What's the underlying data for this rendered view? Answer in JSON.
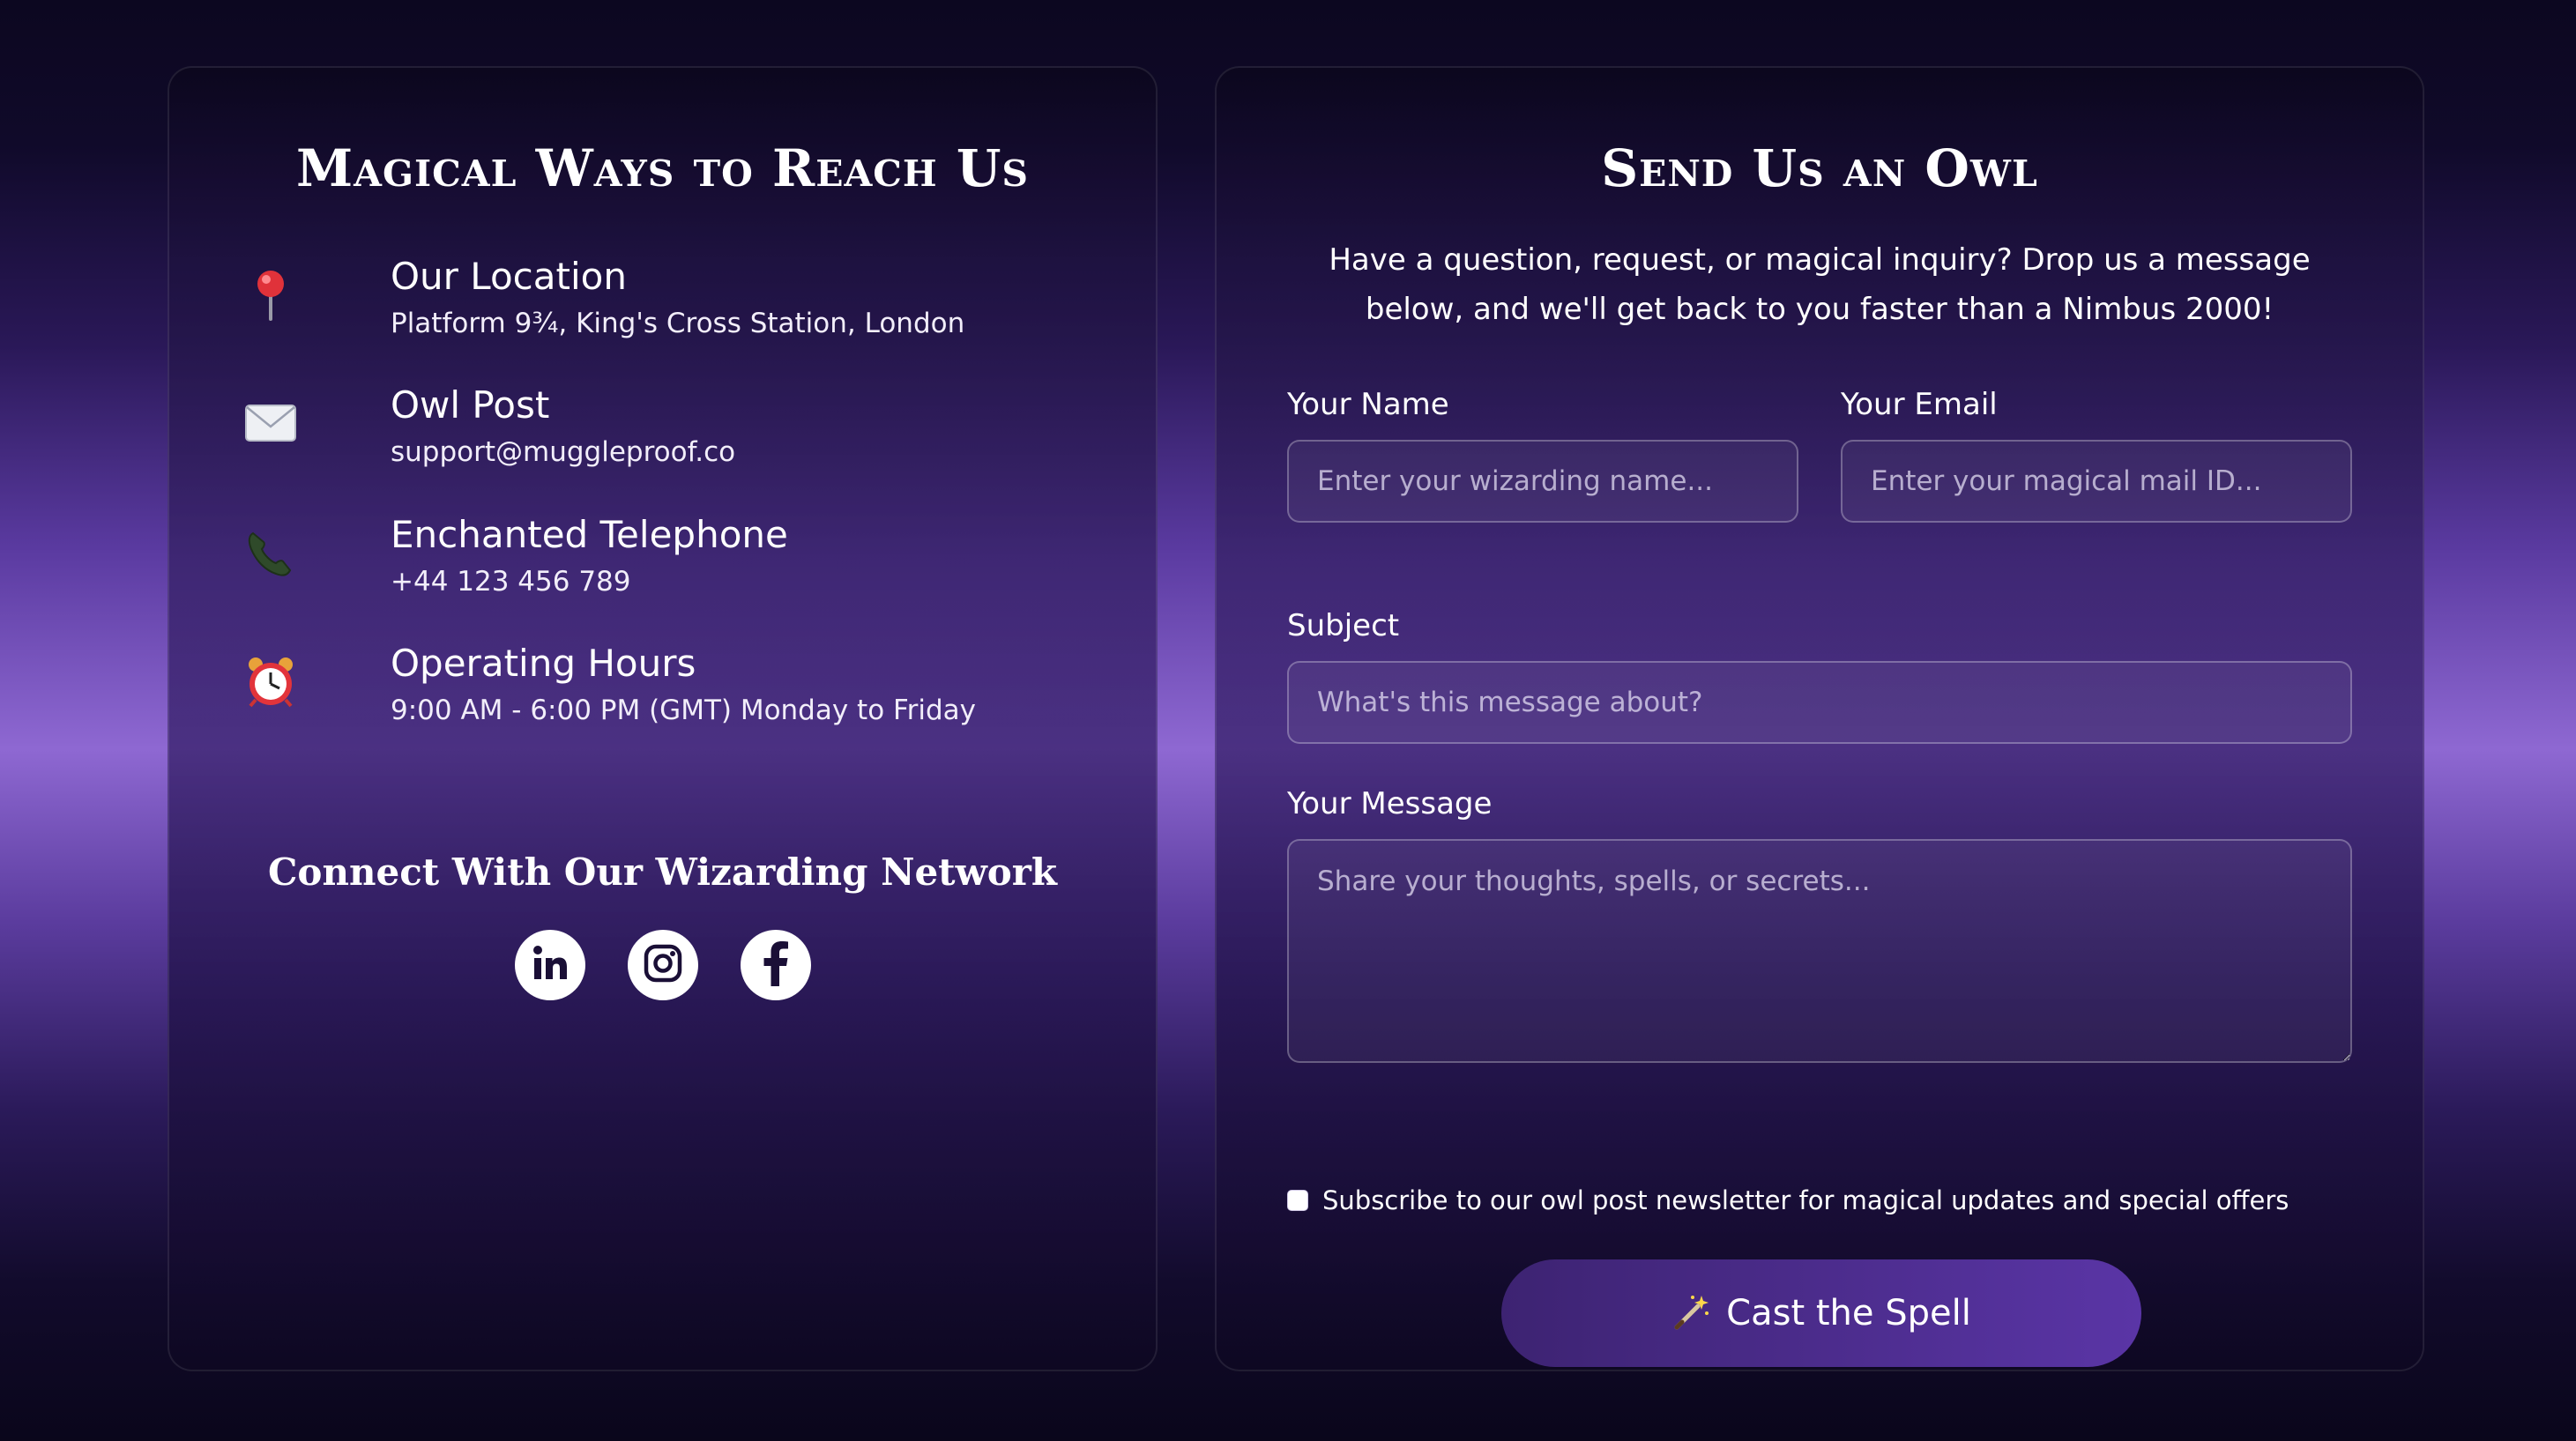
{
  "contact": {
    "title": "Magical Ways to Reach Us",
    "items": [
      {
        "icon": "pin-icon",
        "title": "Our Location",
        "text": "Platform 9¾, King's Cross Station, London"
      },
      {
        "icon": "envelope-icon",
        "title": "Owl Post",
        "text": "support@muggleproof.co"
      },
      {
        "icon": "telephone-icon",
        "title": "Enchanted Telephone",
        "text": "+44 123 456 789"
      },
      {
        "icon": "alarm-clock-icon",
        "title": "Operating Hours",
        "text": "9:00 AM - 6:00 PM (GMT) Monday to Friday"
      }
    ],
    "social_heading": "Connect With Our Wizarding Network",
    "social": [
      {
        "icon": "linkedin-icon"
      },
      {
        "icon": "instagram-icon"
      },
      {
        "icon": "facebook-icon"
      }
    ]
  },
  "form": {
    "title": "Send Us an Owl",
    "intro": "Have a question, request, or magical inquiry? Drop us a message below, and we'll get back to you faster than a Nimbus 2000!",
    "name_label": "Your Name",
    "name_placeholder": "Enter your wizarding name...",
    "email_label": "Your Email",
    "email_placeholder": "Enter your magical mail ID...",
    "subject_label": "Subject",
    "subject_placeholder": "What's this message about?",
    "message_label": "Your Message",
    "message_placeholder": "Share your thoughts, spells, or secrets...",
    "subscribe_label": "Subscribe to our owl post newsletter for magical updates and special offers",
    "subscribe_checked": false,
    "submit_icon": "magic-wand-icon",
    "submit_label": "Cast the Spell"
  },
  "colors": {
    "accent": "#5a35a6",
    "card_bg": "#1e1240",
    "page_glow": "#8e68d2"
  }
}
